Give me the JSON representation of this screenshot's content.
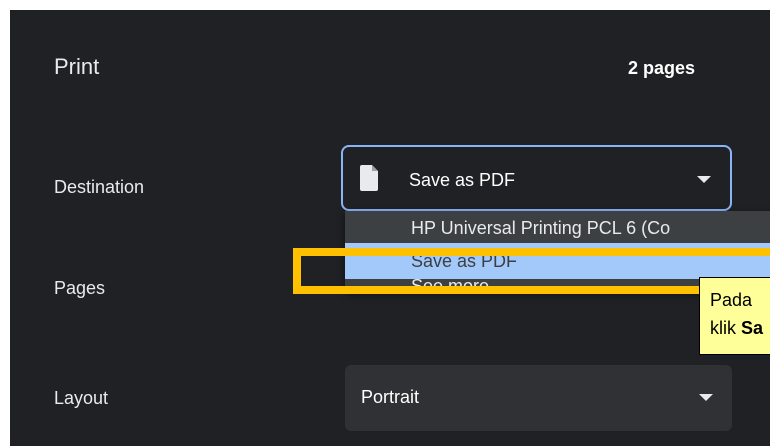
{
  "header": {
    "title": "Print",
    "page_count": "2 pages"
  },
  "labels": {
    "destination": "Destination",
    "pages": "Pages",
    "layout": "Layout"
  },
  "destination": {
    "selected": "Save as PDF",
    "options": [
      "HP Universal Printing PCL 6 (Co",
      "Save as PDF",
      "See more..."
    ],
    "highlighted_option": "Save as PDF"
  },
  "layout": {
    "selected": "Portrait"
  },
  "annotation": {
    "line1": "Pada",
    "line2_prefix": "klik ",
    "line2_bold": "Sa"
  },
  "colors": {
    "panel_bg": "#202124",
    "focus_border": "#8ab4f8",
    "selected_option_bg": "#a3c9fb",
    "highlight_box": "#ffc000",
    "callout_bg": "#ffff99"
  },
  "icons": {
    "destination": "file-icon",
    "dropdown": "chevron-down-icon"
  }
}
